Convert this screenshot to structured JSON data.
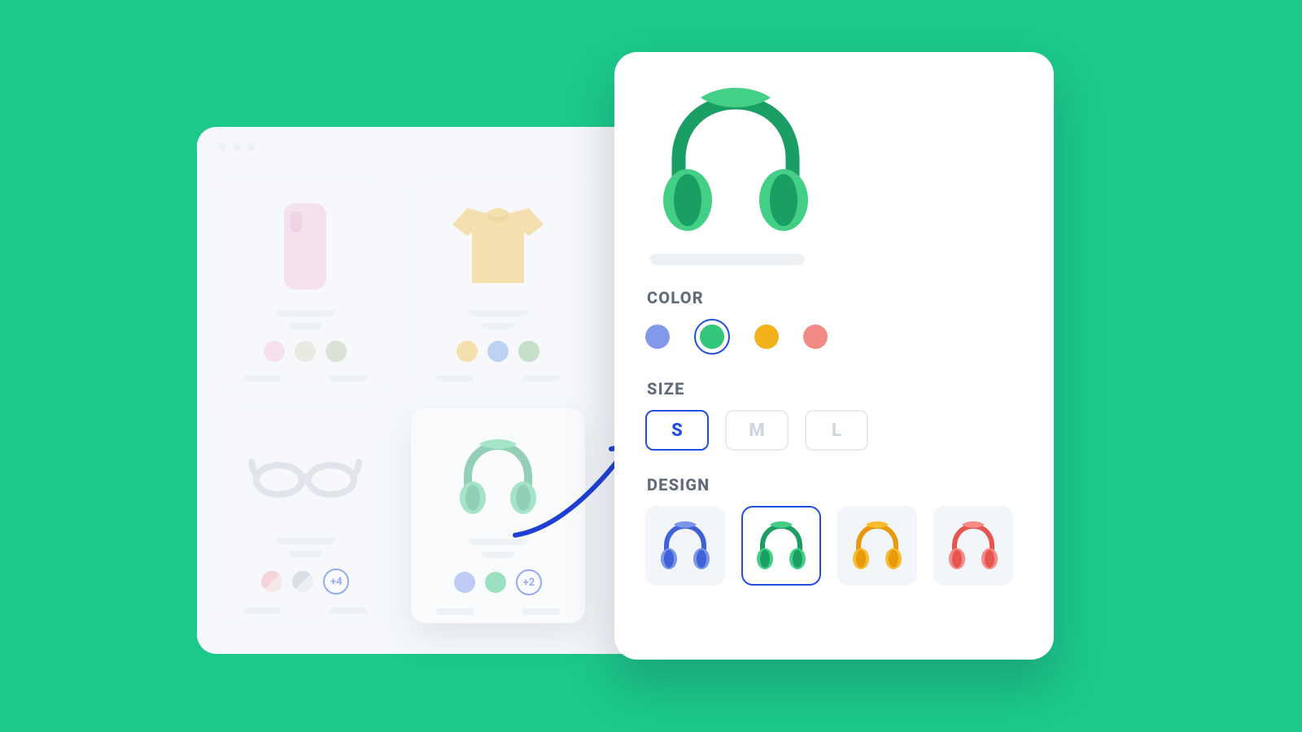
{
  "catalog": {
    "cards": [
      {
        "id": "phone-case",
        "swatches": [
          "#f4c4de",
          "#d9dbc6",
          "#b6c7a6"
        ]
      },
      {
        "id": "tshirt",
        "swatches": [
          "#f1c453",
          "#7aa7e8",
          "#8bc28b"
        ]
      },
      {
        "id": "sneaker",
        "swatch_icons": [
          "sneaker",
          "sneaker"
        ],
        "icon_colors": [
          "#a7c1ea",
          "#e7da8c"
        ]
      },
      {
        "id": "glasses",
        "swatches": [
          "#e8a1a1",
          "#c3cbd4"
        ],
        "more_badge": "+4"
      },
      {
        "id": "headphones",
        "swatches": [
          "#7a96ea",
          "#2fc47f"
        ],
        "more_badge": "+2",
        "active": true
      },
      {
        "id": "handbag",
        "swatches": [
          "#cbb79a",
          "#bfc6cf"
        ]
      }
    ]
  },
  "detail": {
    "labels": {
      "color": "COLOR",
      "size": "SIZE",
      "design": "DESIGN"
    },
    "colors": [
      {
        "name": "blue",
        "hex": "#8199ec",
        "selected": false
      },
      {
        "name": "green",
        "hex": "#34c77b",
        "selected": true
      },
      {
        "name": "yellow",
        "hex": "#f3b21b",
        "selected": false
      },
      {
        "name": "pink",
        "hex": "#f08b86",
        "selected": false
      }
    ],
    "sizes": [
      {
        "label": "S",
        "selected": true
      },
      {
        "label": "M",
        "selected": false
      },
      {
        "label": "L",
        "selected": false
      }
    ],
    "designs": [
      {
        "name": "blue",
        "primary": "#3f63d6",
        "secondary": "#7b95e8",
        "selected": false
      },
      {
        "name": "green",
        "primary": "#1a9e63",
        "secondary": "#44cf87",
        "selected": true
      },
      {
        "name": "yellow",
        "primary": "#e79a0c",
        "secondary": "#f7bd2e",
        "selected": false
      },
      {
        "name": "red",
        "primary": "#e5564f",
        "secondary": "#f48b86",
        "selected": false
      }
    ]
  }
}
